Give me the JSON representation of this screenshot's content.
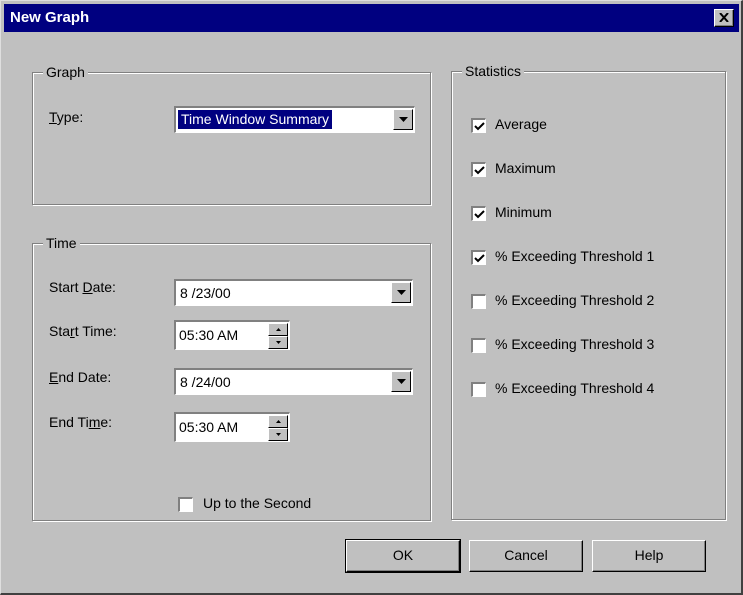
{
  "window": {
    "title": "New Graph"
  },
  "graph": {
    "legend": "Graph",
    "type_label": "Type:",
    "type_value": "Time Window Summary"
  },
  "time": {
    "legend": "Time",
    "start_date_label": "Start Date:",
    "start_date_value": "8 /23/00",
    "start_time_label": "Start Time:",
    "start_time_value": "05:30 AM",
    "end_date_label": "End Date:",
    "end_date_value": "8 /24/00",
    "end_time_label": "End Time:",
    "end_time_value": "05:30 AM",
    "up_to_second_label": "Up to the Second",
    "up_to_second_checked": false
  },
  "statistics": {
    "legend": "Statistics",
    "items": [
      {
        "label": "Average",
        "checked": true
      },
      {
        "label": "Maximum",
        "checked": true
      },
      {
        "label": "Minimum",
        "checked": true
      },
      {
        "label": "% Exceeding Threshold 1",
        "checked": true
      },
      {
        "label": "% Exceeding Threshold 2",
        "checked": false
      },
      {
        "label": "% Exceeding Threshold 3",
        "checked": false
      },
      {
        "label": "% Exceeding Threshold 4",
        "checked": false
      }
    ]
  },
  "buttons": {
    "ok": "OK",
    "cancel": "Cancel",
    "help": "Help"
  }
}
